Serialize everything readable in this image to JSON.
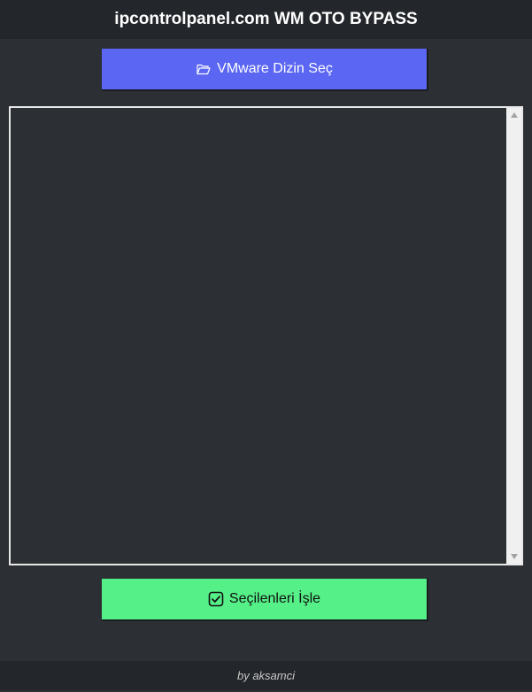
{
  "window": {
    "title": "ipcontrolpanel.com WM OTO BYPASS"
  },
  "buttons": {
    "select_dir_label": "VMware Dizin Seç",
    "select_dir_icon": "folder-open-icon",
    "process_label": "Seçilenleri İşle",
    "process_icon": "checkbox-checked-icon"
  },
  "list": {
    "items": []
  },
  "footer": {
    "credit": "by aksamci"
  },
  "colors": {
    "background": "#2c2f34",
    "header": "#23262a",
    "select_button": "#5b66f2",
    "process_button": "#55f087"
  }
}
